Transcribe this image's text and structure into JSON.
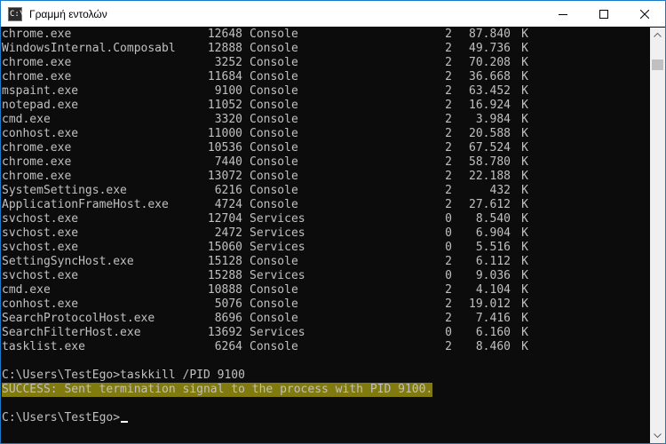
{
  "window": {
    "title": "Γραμμή εντολών",
    "icon_name": "command-prompt-icon",
    "icon_glyph": "C:\\",
    "controls": [
      "minimize-icon",
      "maximize-icon",
      "close-icon"
    ]
  },
  "processes": [
    {
      "name": "chrome.exe",
      "pid": "12648",
      "session_name": "Console",
      "session_num": "2",
      "mem": "87.840",
      "unit": "K"
    },
    {
      "name": "WindowsInternal.Composabl",
      "pid": "12888",
      "session_name": "Console",
      "session_num": "2",
      "mem": "49.736",
      "unit": "K"
    },
    {
      "name": "chrome.exe",
      "pid": "3252",
      "session_name": "Console",
      "session_num": "2",
      "mem": "70.208",
      "unit": "K"
    },
    {
      "name": "chrome.exe",
      "pid": "11684",
      "session_name": "Console",
      "session_num": "2",
      "mem": "36.668",
      "unit": "K"
    },
    {
      "name": "mspaint.exe",
      "pid": "9100",
      "session_name": "Console",
      "session_num": "2",
      "mem": "63.452",
      "unit": "K"
    },
    {
      "name": "notepad.exe",
      "pid": "11052",
      "session_name": "Console",
      "session_num": "2",
      "mem": "16.924",
      "unit": "K"
    },
    {
      "name": "cmd.exe",
      "pid": "3320",
      "session_name": "Console",
      "session_num": "2",
      "mem": "3.984",
      "unit": "K"
    },
    {
      "name": "conhost.exe",
      "pid": "11000",
      "session_name": "Console",
      "session_num": "2",
      "mem": "20.588",
      "unit": "K"
    },
    {
      "name": "chrome.exe",
      "pid": "10536",
      "session_name": "Console",
      "session_num": "2",
      "mem": "67.524",
      "unit": "K"
    },
    {
      "name": "chrome.exe",
      "pid": "7440",
      "session_name": "Console",
      "session_num": "2",
      "mem": "58.780",
      "unit": "K"
    },
    {
      "name": "chrome.exe",
      "pid": "13072",
      "session_name": "Console",
      "session_num": "2",
      "mem": "22.188",
      "unit": "K"
    },
    {
      "name": "SystemSettings.exe",
      "pid": "6216",
      "session_name": "Console",
      "session_num": "2",
      "mem": "432",
      "unit": "K"
    },
    {
      "name": "ApplicationFrameHost.exe",
      "pid": "4724",
      "session_name": "Console",
      "session_num": "2",
      "mem": "27.612",
      "unit": "K"
    },
    {
      "name": "svchost.exe",
      "pid": "12704",
      "session_name": "Services",
      "session_num": "0",
      "mem": "8.540",
      "unit": "K"
    },
    {
      "name": "svchost.exe",
      "pid": "2472",
      "session_name": "Services",
      "session_num": "0",
      "mem": "6.904",
      "unit": "K"
    },
    {
      "name": "svchost.exe",
      "pid": "15060",
      "session_name": "Services",
      "session_num": "0",
      "mem": "5.516",
      "unit": "K"
    },
    {
      "name": "SettingSyncHost.exe",
      "pid": "15128",
      "session_name": "Console",
      "session_num": "2",
      "mem": "6.112",
      "unit": "K"
    },
    {
      "name": "svchost.exe",
      "pid": "15288",
      "session_name": "Services",
      "session_num": "0",
      "mem": "9.036",
      "unit": "K"
    },
    {
      "name": "cmd.exe",
      "pid": "10888",
      "session_name": "Console",
      "session_num": "2",
      "mem": "4.104",
      "unit": "K"
    },
    {
      "name": "conhost.exe",
      "pid": "5076",
      "session_name": "Console",
      "session_num": "2",
      "mem": "19.012",
      "unit": "K"
    },
    {
      "name": "SearchProtocolHost.exe",
      "pid": "8696",
      "session_name": "Console",
      "session_num": "2",
      "mem": "7.416",
      "unit": "K"
    },
    {
      "name": "SearchFilterHost.exe",
      "pid": "13692",
      "session_name": "Services",
      "session_num": "0",
      "mem": "6.160",
      "unit": "K"
    },
    {
      "name": "tasklist.exe",
      "pid": "6264",
      "session_name": "Console",
      "session_num": "2",
      "mem": "8.460",
      "unit": "K"
    }
  ],
  "command_line": "C:\\Users\\TestEgo>taskkill /PID 9100",
  "success_message": "SUCCESS: Sent termination signal to the process with PID 9100.",
  "prompt": "C:\\Users\\TestEgo>",
  "colors": {
    "console_bg": "#0c0c0c",
    "console_text": "#c0c0c0",
    "highlight_bg": "#807a0f",
    "window_border": "#1979ca"
  }
}
